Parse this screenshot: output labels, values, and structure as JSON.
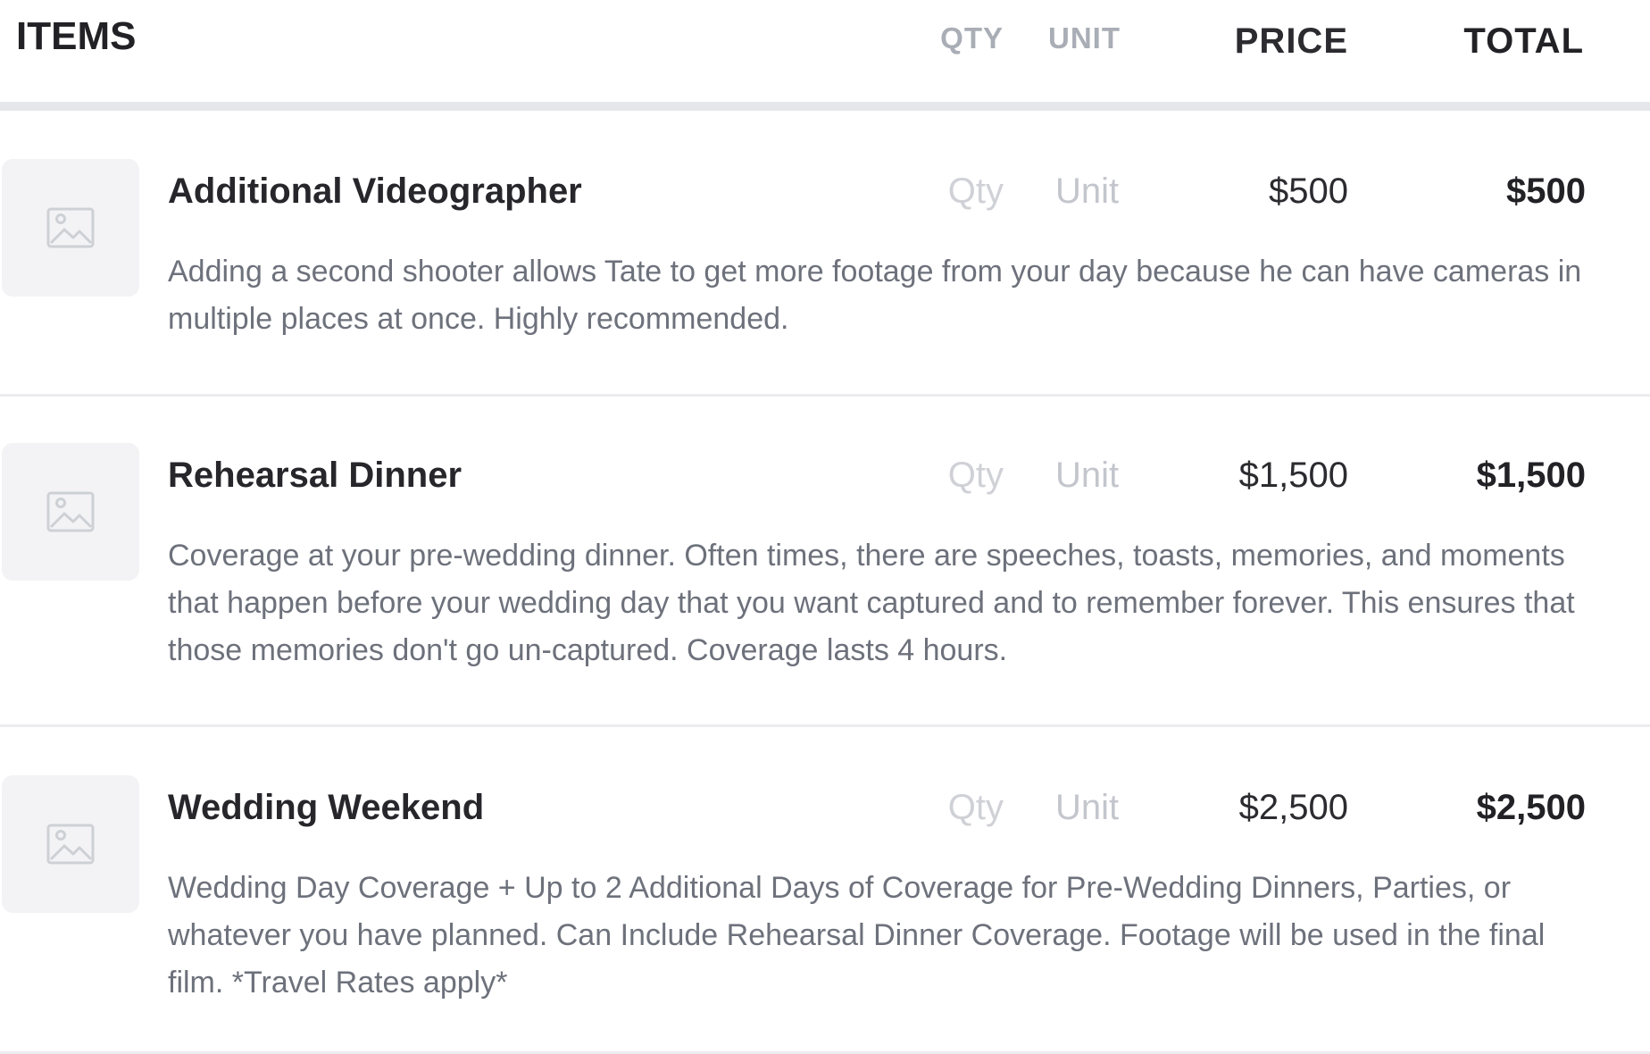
{
  "header": {
    "title": "ITEMS",
    "columns": {
      "qty": "QTY",
      "unit": "UNIT",
      "price": "PRICE",
      "total": "TOTAL"
    }
  },
  "items": [
    {
      "name": "Additional Videographer",
      "qty_placeholder": "Qty",
      "unit_placeholder": "Unit",
      "price": "$500",
      "total": "$500",
      "description": "Adding a second shooter allows Tate to get more footage from your day because he can have cameras in multiple places at once. Highly recommended."
    },
    {
      "name": "Rehearsal Dinner",
      "qty_placeholder": "Qty",
      "unit_placeholder": "Unit",
      "price": "$1,500",
      "total": "$1,500",
      "description": "Coverage at your pre-wedding dinner. Often times, there are speeches, toasts, memories, and moments that happen before your wedding day that you want captured and to remember forever. This ensures that those memories don't go un-captured. Coverage lasts 4 hours."
    },
    {
      "name": "Wedding Weekend",
      "qty_placeholder": "Qty",
      "unit_placeholder": "Unit",
      "price": "$2,500",
      "total": "$2,500",
      "description": "Wedding Day Coverage + Up to 2 Additional Days of Coverage for Pre-Wedding Dinners, Parties, or whatever you have planned. Can Include Rehearsal Dinner Coverage. Footage will be used in the final film. *Travel Rates apply*"
    }
  ],
  "icons": {
    "thumbnail": "image-placeholder-icon"
  },
  "colors": {
    "header_text": "#a9adb5",
    "description": "#6d717b",
    "placeholder": "#cfd1d6"
  }
}
